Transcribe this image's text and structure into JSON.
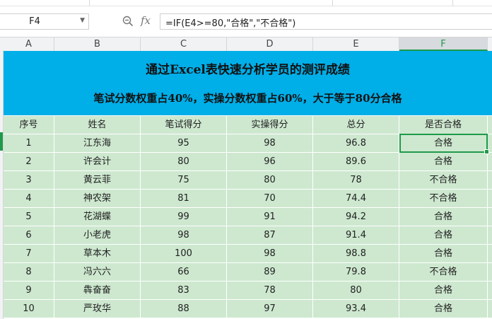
{
  "formula_bar": {
    "name_box": "F4",
    "zoom_icon": "magnifier-icon",
    "fx_label": "fx",
    "formula": "=IF(E4>=80,\"合格\",\"不合格\")"
  },
  "columns": [
    "A",
    "B",
    "C",
    "D",
    "E",
    "F"
  ],
  "active_column": "F",
  "title": {
    "main": "通过Excel表快速分析学员的测评成绩",
    "sub": "笔试分数权重占40%，实操分数权重占60%，大于等于80分合格"
  },
  "table": {
    "headers": [
      "序号",
      "姓名",
      "笔试得分",
      "实操得分",
      "总分",
      "是否合格"
    ],
    "rows": [
      [
        "1",
        "江东海",
        "95",
        "98",
        "96.8",
        "合格"
      ],
      [
        "2",
        "许会计",
        "80",
        "96",
        "89.6",
        "合格"
      ],
      [
        "3",
        "黄云菲",
        "75",
        "80",
        "78",
        "不合格"
      ],
      [
        "4",
        "神农架",
        "81",
        "70",
        "74.4",
        "不合格"
      ],
      [
        "5",
        "花湖蝶",
        "99",
        "91",
        "94.2",
        "合格"
      ],
      [
        "6",
        "小老虎",
        "98",
        "87",
        "91.4",
        "合格"
      ],
      [
        "7",
        "草本木",
        "100",
        "98",
        "98.8",
        "合格"
      ],
      [
        "8",
        "冯六六",
        "66",
        "89",
        "79.8",
        "不合格"
      ],
      [
        "9",
        "犇奋奋",
        "83",
        "78",
        "80",
        "合格"
      ],
      [
        "10",
        "严玫华",
        "88",
        "97",
        "93.4",
        "合格"
      ]
    ]
  },
  "colors": {
    "title_fill": "#00aee8",
    "table_fill": "#cde8cf",
    "selection": "#1f9a4a"
  }
}
